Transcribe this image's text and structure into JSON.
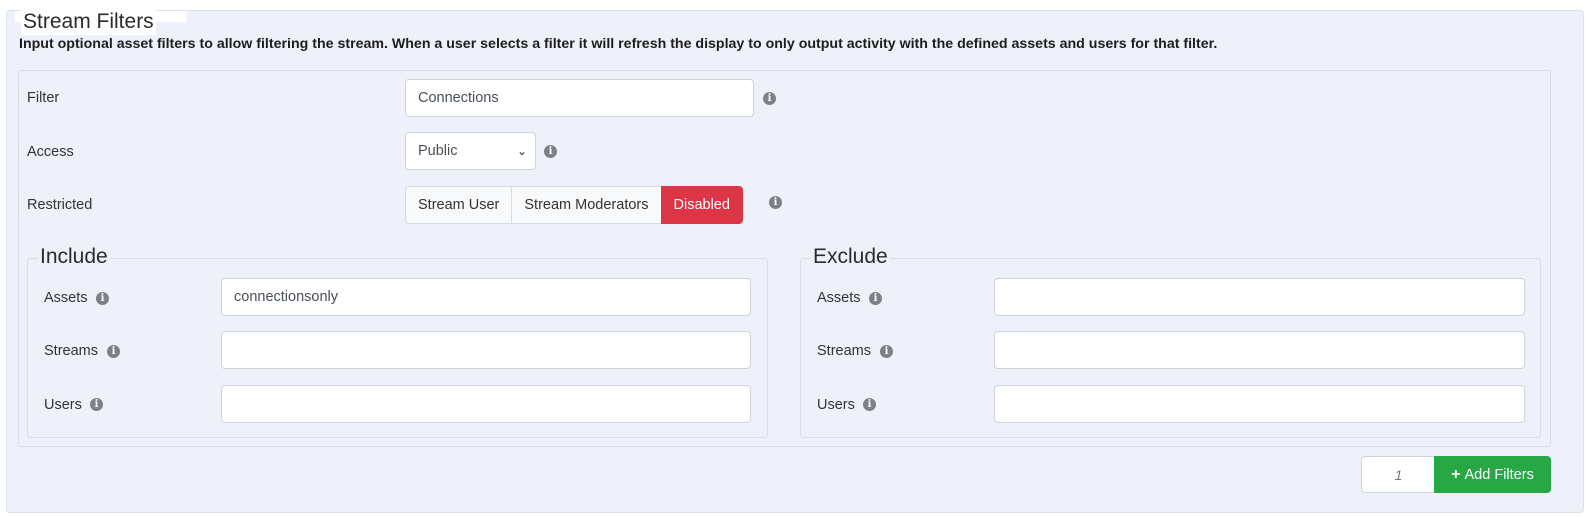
{
  "section": {
    "title": "Stream Filters",
    "intro": "Input optional asset filters to allow filtering the stream. When a user selects a filter it will refresh the display to only output activity with the defined assets and users for that filter."
  },
  "filter": {
    "label": "Filter",
    "value": "Connections"
  },
  "access": {
    "label": "Access",
    "selected": "Public"
  },
  "restricted": {
    "label": "Restricted",
    "options": [
      "Stream User",
      "Stream Moderators",
      "Disabled"
    ],
    "active": "Disabled"
  },
  "include": {
    "title": "Include",
    "assets_label": "Assets",
    "assets_value": "connectionsonly",
    "streams_label": "Streams",
    "streams_value": "",
    "users_label": "Users",
    "users_value": ""
  },
  "exclude": {
    "title": "Exclude",
    "assets_label": "Assets",
    "assets_value": "",
    "streams_label": "Streams",
    "streams_value": "",
    "users_label": "Users",
    "users_value": ""
  },
  "footer": {
    "count_placeholder": "1",
    "add_label": "Add Filters"
  },
  "icons": {
    "info": "info-icon",
    "chevron": "chevron-down-icon",
    "plus": "plus-icon"
  },
  "colors": {
    "danger": "#dc3545",
    "success": "#28a745"
  }
}
